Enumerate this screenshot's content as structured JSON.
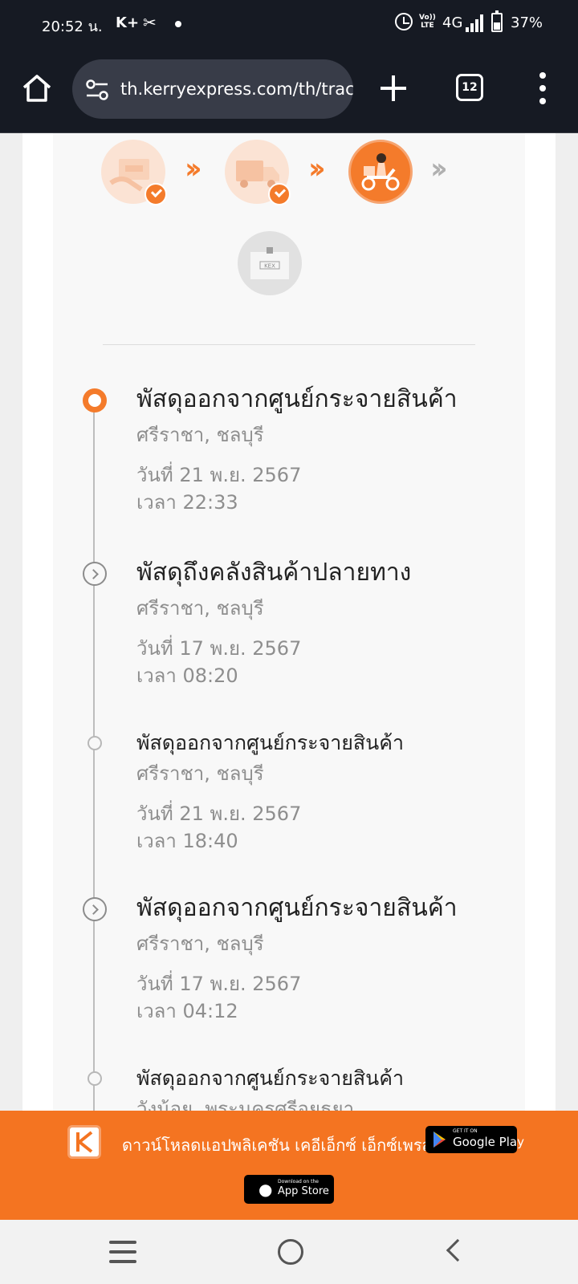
{
  "status_bar": {
    "time": "20:52 น.",
    "carrier": "K+",
    "network_type": "4G",
    "volte_label": "Vo)) LTE",
    "battery": "37%"
  },
  "browser": {
    "url": "th.kerryexpress.com/th/track",
    "tab_count": "12"
  },
  "progress": {
    "stages": [
      {
        "name": "parcel-received",
        "state": "done"
      },
      {
        "name": "in-transit-truck",
        "state": "done"
      },
      {
        "name": "out-for-delivery-scooter",
        "state": "active"
      },
      {
        "name": "delivered-box",
        "state": "pending"
      }
    ],
    "box_label": "KEX"
  },
  "timeline": {
    "events": [
      {
        "title": "พัสดุออกจากศูนย์กระจายสินค้า",
        "location": "ศรีราชา, ชลบุรี",
        "date": "วันที่ 21 พ.ย. 2567",
        "time": "เวลา 22:33"
      },
      {
        "title": "พัสดุถึงคลังสินค้าปลายทาง",
        "location": "ศรีราชา, ชลบุรี",
        "date": "วันที่ 17 พ.ย. 2567",
        "time": "เวลา 08:20"
      },
      {
        "title": "พัสดุออกจากศูนย์กระจายสินค้า",
        "location": "ศรีราชา, ชลบุรี",
        "date": "วันที่ 21 พ.ย. 2567",
        "time": "เวลา 18:40"
      },
      {
        "title": "พัสดุออกจากศูนย์กระจายสินค้า",
        "location": "ศรีราชา, ชลบุรี",
        "date": "วันที่ 17 พ.ย. 2567",
        "time": "เวลา 04:12"
      },
      {
        "title": "พัสดุออกจากศูนย์กระจายสินค้า",
        "location": "วังน้อย, พระนครศรีอยุธยา"
      }
    ]
  },
  "banner": {
    "text": "ดาวน์โหลดแอปพลิเคชัน เคอีเอ็กซ์ เอ็กซ์เพรส",
    "google_play_small": "GET IT ON",
    "google_play_label": "Google Play",
    "app_store_small": "Download on the",
    "app_store_label": "App Store",
    "accent_color": "#f47421"
  },
  "colors": {
    "brand_orange": "#f47b2b",
    "status_bar_bg": "#161a23"
  }
}
